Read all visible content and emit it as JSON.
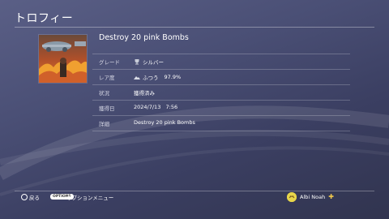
{
  "screen": {
    "title": "トロフィー"
  },
  "trophy": {
    "name": "Destroy 20 pink Bombs",
    "image_icon": "trophy-artwork-icon",
    "details": [
      {
        "label": "グレード",
        "value": "シルバー",
        "icon": "trophy-cup-icon",
        "percent": ""
      },
      {
        "label": "レア度",
        "value": "ふつう",
        "icon": "rarity-icon",
        "percent": "97.9%"
      },
      {
        "label": "状況",
        "value": "獲得済み",
        "icon": "",
        "percent": ""
      },
      {
        "label": "獲得日",
        "value": "2024/7/13   7:56",
        "icon": "",
        "percent": ""
      },
      {
        "label": "詳細",
        "value": "Destroy 20 pink Bombs",
        "icon": "",
        "percent": ""
      }
    ]
  },
  "footer": {
    "back_icon": "circle-button-icon",
    "back_label": "戻る",
    "options_button_text": "OPTIONS",
    "options_label": "オプションメニュー"
  },
  "user": {
    "name": "Albi Noah",
    "avatar_icon": "avatar-icon",
    "plus_icon": "playstation-plus-icon",
    "plus_color": "#f2c94c"
  }
}
